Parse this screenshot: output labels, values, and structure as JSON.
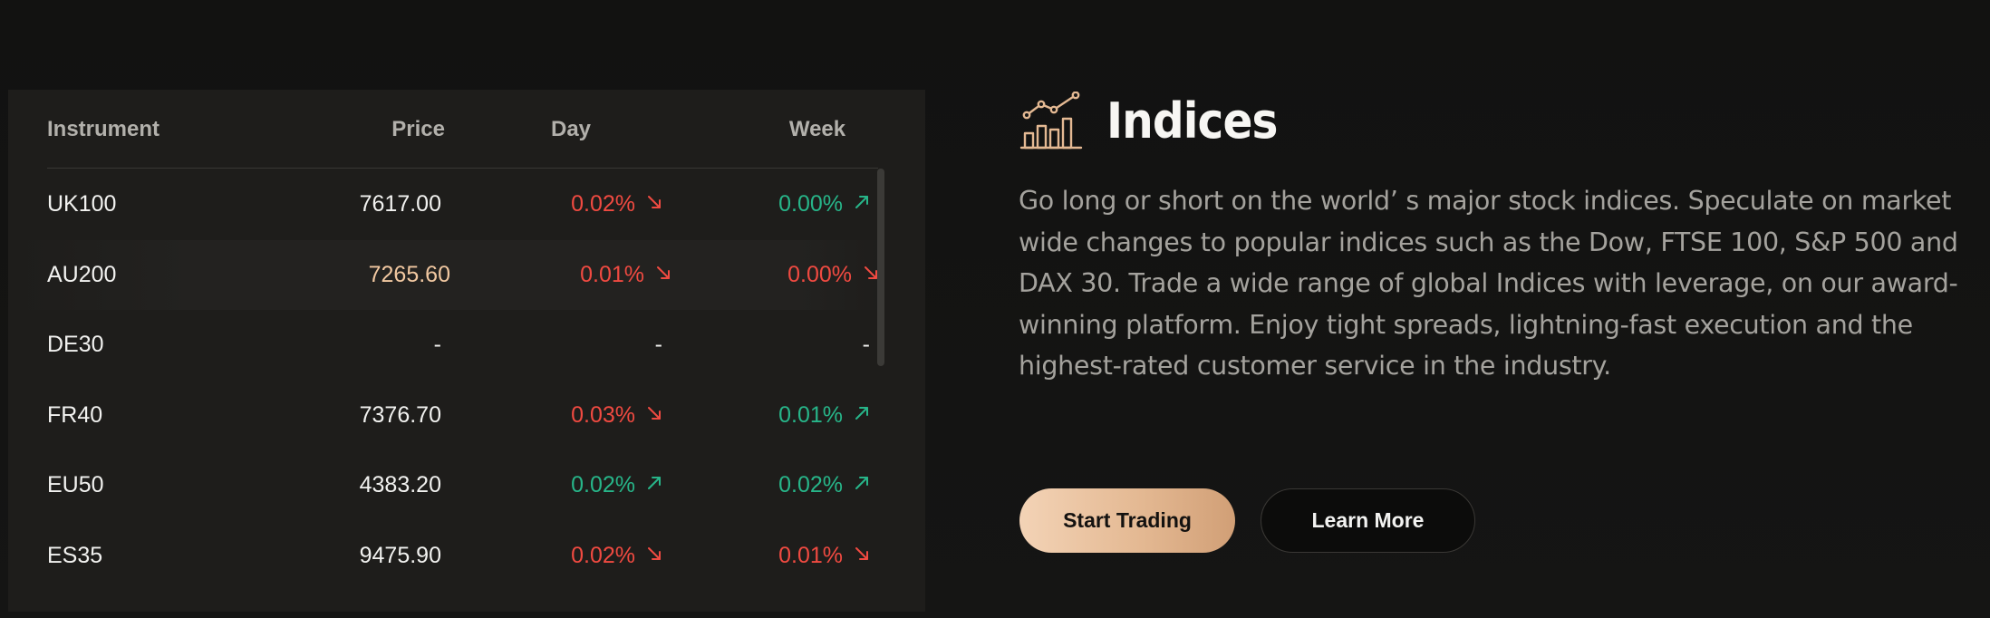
{
  "table": {
    "headers": {
      "instrument": "Instrument",
      "price": "Price",
      "day": "Day",
      "week": "Week"
    },
    "rows": [
      {
        "instrument": "UK100",
        "price": "7617.00",
        "day": "0.02%",
        "day_dir": "down",
        "week": "0.00%",
        "week_dir": "up",
        "price_color": "#f2f2f0"
      },
      {
        "instrument": "AU200",
        "price": "7265.60",
        "day": "0.01%",
        "day_dir": "down",
        "week": "0.00%",
        "week_dir": "down",
        "price_color": "#f1c8a1"
      },
      {
        "instrument": "DE30",
        "price": "-",
        "day": "-",
        "day_dir": "none",
        "week": "-",
        "week_dir": "none",
        "price_color": "#f2f2f0"
      },
      {
        "instrument": "FR40",
        "price": "7376.70",
        "day": "0.03%",
        "day_dir": "down",
        "week": "0.01%",
        "week_dir": "up",
        "price_color": "#f2f2f0"
      },
      {
        "instrument": "EU50",
        "price": "4383.20",
        "day": "0.02%",
        "day_dir": "up",
        "week": "0.02%",
        "week_dir": "up",
        "price_color": "#f2f2f0"
      },
      {
        "instrument": "ES35",
        "price": "9475.90",
        "day": "0.02%",
        "day_dir": "down",
        "week": "0.01%",
        "week_dir": "down",
        "price_color": "#f2f2f0"
      }
    ]
  },
  "section": {
    "icon": "rising-bar-chart-icon",
    "title": "Indices",
    "description": "Go long or short on the world’  s major stock indices. Speculate on market wide changes to popular indices such as the Dow, FTSE 100, S&P 500 and DAX 30. Trade a wide range of global Indices with leverage, on our award-winning platform. Enjoy tight spreads, lightning-fast execution and the highest-rated customer service in the industry."
  },
  "buttons": {
    "start_trading": "Start Trading",
    "learn_more": "Learn More"
  },
  "colors": {
    "down": "#f04a41",
    "up": "#27b589",
    "accent": "#e4b993",
    "background": "#131312",
    "panel": "#1e1d1b"
  }
}
